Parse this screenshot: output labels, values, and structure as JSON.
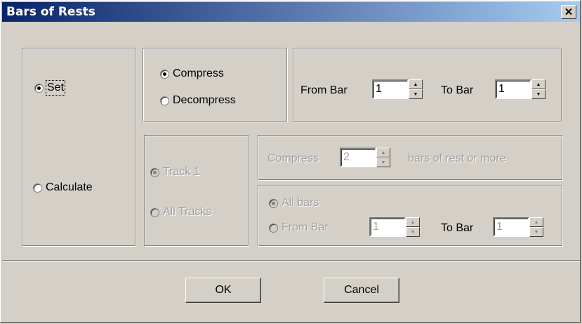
{
  "window": {
    "title": "Bars of Rests",
    "close_glyph": "✕"
  },
  "mode": {
    "set_label": "Set",
    "calculate_label": "Calculate",
    "selected": "Set"
  },
  "set_panel": {
    "compress_label": "Compress",
    "decompress_label": "Decompress",
    "selected": "Compress",
    "from_bar_label": "From Bar",
    "from_bar_value": "1",
    "to_bar_label": "To Bar",
    "to_bar_value": "1"
  },
  "calculate_panel": {
    "track1_label": "Track 1",
    "all_tracks_label": "All Tracks",
    "compress_label": "Compress",
    "compress_value": "2",
    "bars_of_rest_label": "bars of rest or more",
    "all_bars_label": "All bars",
    "from_bar_label": "From Bar",
    "from_bar_value": "1",
    "to_bar_label": "To Bar",
    "to_bar_value": "1"
  },
  "buttons": {
    "ok_label": "OK",
    "cancel_label": "Cancel"
  },
  "icons": {
    "spin_up": "▲",
    "spin_down": "▼"
  }
}
